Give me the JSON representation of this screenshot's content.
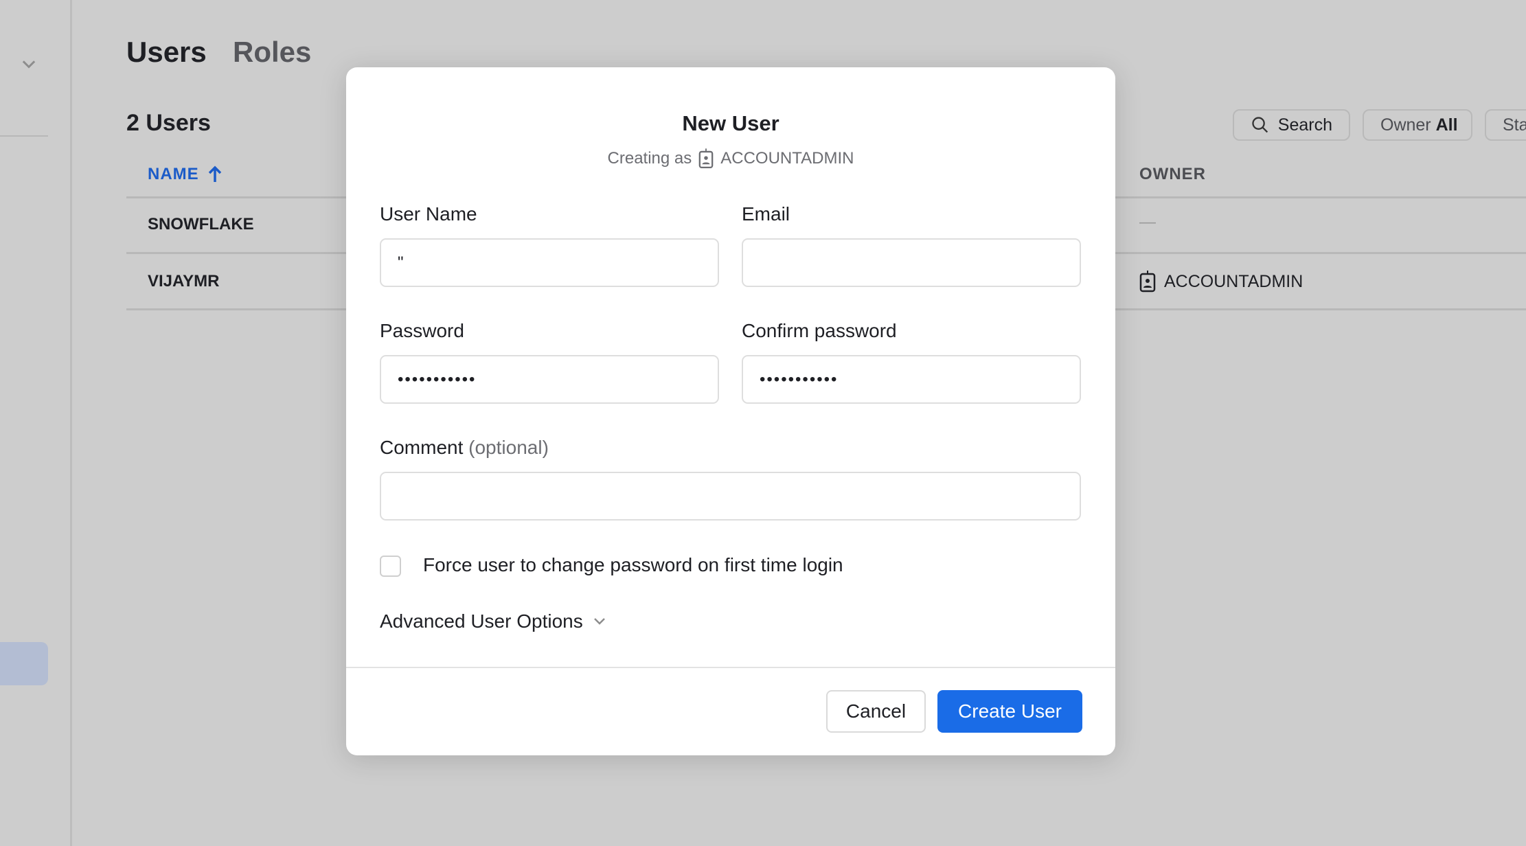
{
  "page": {
    "tabs": [
      {
        "label": "Users",
        "active": true
      },
      {
        "label": "Roles",
        "active": false
      }
    ],
    "user_count": "2 Users",
    "table": {
      "columns": [
        "NAME",
        "OWNER"
      ],
      "sort": "ascending",
      "rows": [
        {
          "name": "SNOWFLAKE",
          "owner": "—"
        },
        {
          "name": "VIJAYMR",
          "owner": "ACCOUNTADMIN",
          "owner_icon": "role-badge-icon"
        }
      ]
    },
    "filters": {
      "search": "Search",
      "owner_label": "Owner",
      "owner_value": "All",
      "status_partial": "Sta"
    }
  },
  "modal": {
    "title": "New User",
    "creating_as_label": "Creating as",
    "creating_as_role": "ACCOUNTADMIN",
    "fields": {
      "user_name": {
        "label": "User Name",
        "value": "\""
      },
      "email": {
        "label": "Email",
        "value": ""
      },
      "password": {
        "label": "Password",
        "value": "•••••••••••"
      },
      "confirm_password": {
        "label": "Confirm password",
        "value": "•••••••••••"
      },
      "comment": {
        "label": "Comment",
        "hint": "(optional)",
        "value": ""
      }
    },
    "force_change": {
      "label": "Force user to change password on first time login",
      "checked": false
    },
    "advanced": "Advanced User Options",
    "cancel": "Cancel",
    "create": "Create User",
    "accent": "#1a6ce7"
  }
}
